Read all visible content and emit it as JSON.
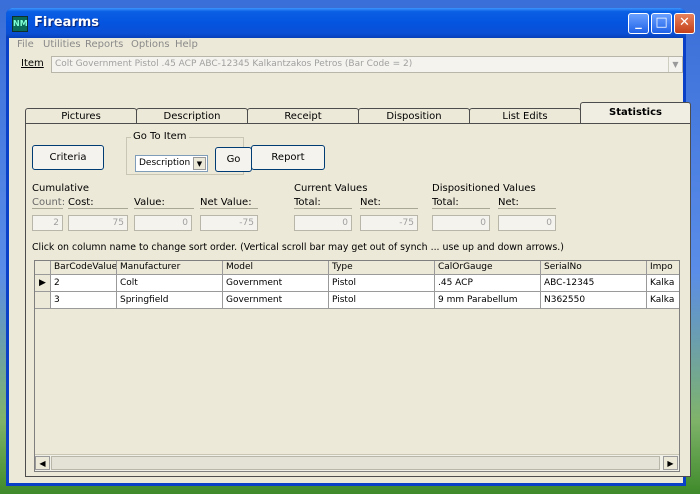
{
  "window": {
    "title": "Firearms",
    "app_icon": "NM",
    "minimize": "_",
    "maximize": "□",
    "close": "✕"
  },
  "menu": [
    "File",
    "Utilities",
    "Reports",
    "Options",
    "Help"
  ],
  "item": {
    "label": "Item",
    "value": "Colt Government Pistol .45 ACP ABC-12345 Kalkantzakos Petros (Bar Code = 2)",
    "drop": "▼"
  },
  "tabs": [
    "Pictures",
    "Description",
    "Receipt",
    "Disposition",
    "List Edits",
    "Statistics"
  ],
  "active_tab": "Statistics",
  "toolbar": {
    "criteria": "Criteria",
    "goto_label": "Go To Item",
    "goto_select": "Description",
    "goto_drop": "▼",
    "go": "Go",
    "report": "Report"
  },
  "cumulative": {
    "title": "Cumulative",
    "count_label": "Count:",
    "count": "2",
    "cost_label": "Cost:",
    "cost": "75",
    "value_label": "Value:",
    "value": "0",
    "net_label": "Net Value:",
    "net": "-75"
  },
  "current": {
    "title": "Current Values",
    "total_label": "Total:",
    "total": "0",
    "net_label": "Net:",
    "net": "-75"
  },
  "dispositioned": {
    "title": "Dispositioned Values",
    "total_label": "Total:",
    "total": "0",
    "net_label": "Net:",
    "net": "0"
  },
  "hint": "Click on column name to change sort order. (Vertical scroll bar may get out of synch ... use up and down arrows.)",
  "grid": {
    "columns": [
      "BarCodeValue",
      "Manufacturer",
      "Model",
      "Type",
      "CalOrGauge",
      "SerialNo",
      "Impo"
    ],
    "rows": [
      [
        "2",
        "Colt",
        "Government",
        "Pistol",
        ".45 ACP",
        "ABC-12345",
        "Kalka"
      ],
      [
        "3",
        "Springfield",
        "Government",
        "Pistol",
        "9 mm Parabellum",
        "N362550",
        "Kalka"
      ]
    ],
    "current_row_marker": "▶",
    "scroll_left": "◀",
    "scroll_right": "▶"
  }
}
